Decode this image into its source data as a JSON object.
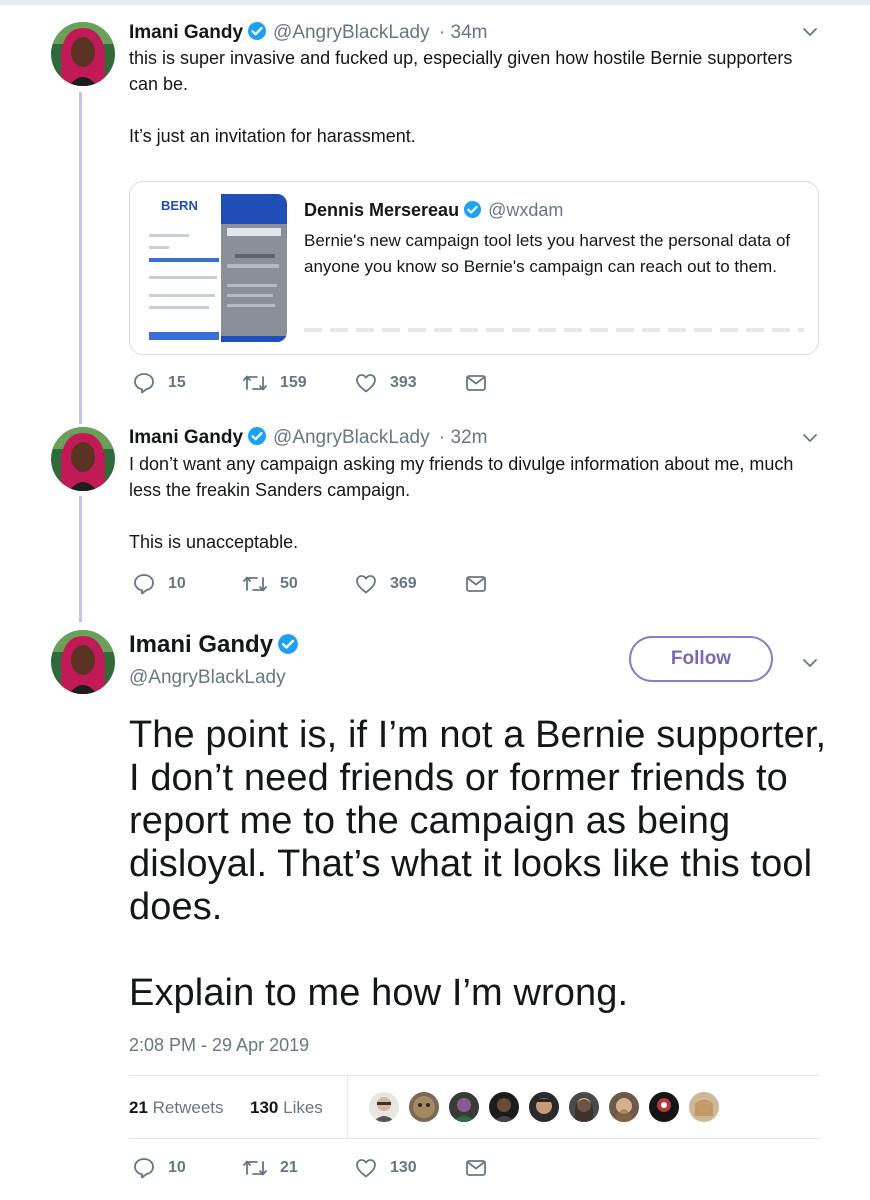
{
  "tweet1": {
    "name": "Imani Gandy",
    "handle": "@AngryBlackLady",
    "time": "· 34m",
    "paragraphs": [
      "this is super invasive and fucked up, especially given how hostile Bernie supporters can be.",
      "It’s just an invitation for harassment."
    ],
    "quote": {
      "thumb_logo": "BERN",
      "name": "Dennis Mersereau",
      "handle": "@wxdam",
      "text": "Bernie's new campaign tool lets you harvest the personal data of anyone you know so Bernie's campaign can reach out to them."
    },
    "replies": "15",
    "retweets": "159",
    "likes": "393"
  },
  "tweet2": {
    "name": "Imani Gandy",
    "handle": "@AngryBlackLady",
    "time": "· 32m",
    "paragraphs": [
      "I don’t want any campaign asking my friends to divulge information about me, much less the freakin Sanders campaign.",
      "This is unacceptable."
    ],
    "replies": "10",
    "retweets": "50",
    "likes": "369"
  },
  "main_tweet": {
    "name": "Imani Gandy",
    "handle": "@AngryBlackLady",
    "follow_label": "Follow",
    "paragraphs": [
      "The point is, if I’m not a Bernie supporter, I don’t need friends or former friends to report me to the campaign as being disloyal. That’s what it looks like this tool does.",
      "Explain to me how I’m wrong."
    ],
    "timestamp": "2:08 PM - 29 Apr 2019",
    "retweet_count": "21",
    "retweet_label": "Retweets",
    "like_count": "130",
    "like_label": "Likes",
    "replies": "10",
    "retweets": "21",
    "likes": "130"
  },
  "icons": {
    "reply": "reply-icon",
    "retweet": "retweet-icon",
    "like": "heart-icon",
    "dm": "envelope-icon",
    "verified": "verified-badge-icon",
    "caret": "chevron-down-icon"
  },
  "colors": {
    "thread_line": "#c9c1e6",
    "follow_accent": "#7a67b8",
    "verified": "#1da1f2",
    "muted": "#657786"
  }
}
